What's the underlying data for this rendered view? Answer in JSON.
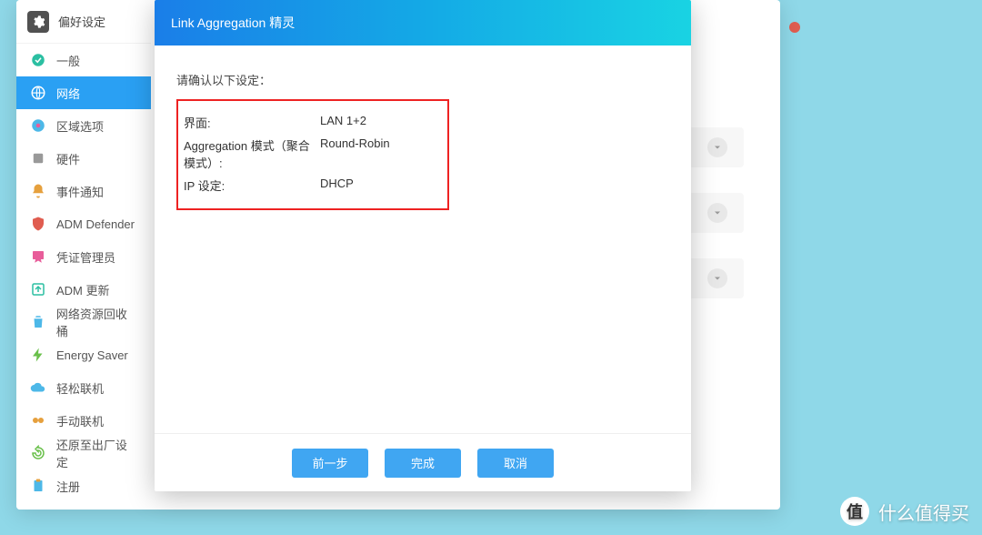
{
  "header": {
    "prefs_title": "偏好设定"
  },
  "sidebar": {
    "items": [
      {
        "label": "一般"
      },
      {
        "label": "网络"
      },
      {
        "label": "区域选项"
      },
      {
        "label": "硬件"
      },
      {
        "label": "事件通知"
      },
      {
        "label": "ADM Defender"
      },
      {
        "label": "凭证管理员"
      },
      {
        "label": "ADM 更新"
      },
      {
        "label": "网络资源回收桶"
      },
      {
        "label": "Energy Saver"
      },
      {
        "label": "轻松联机"
      },
      {
        "label": "手动联机"
      },
      {
        "label": "还原至出厂设定"
      },
      {
        "label": "注册"
      }
    ]
  },
  "wizard": {
    "title": "Link Aggregation 精灵",
    "confirm_prompt": "请确认以下设定：",
    "rows": {
      "interface_label": "界面:",
      "interface_value": "LAN 1+2",
      "mode_label": "Aggregation 模式（聚合模式）:",
      "mode_value": "Round-Robin",
      "ip_label": "IP 设定:",
      "ip_value": "DHCP"
    },
    "buttons": {
      "prev": "前一步",
      "done": "完成",
      "cancel": "取消"
    }
  },
  "watermark": {
    "badge": "值",
    "text": "什么值得买"
  }
}
